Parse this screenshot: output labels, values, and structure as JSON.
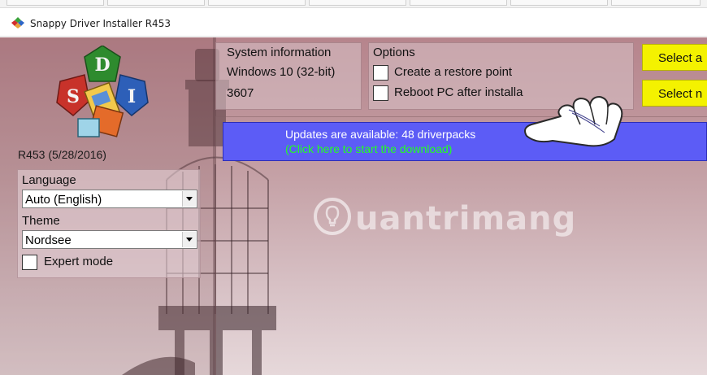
{
  "window": {
    "title": "Snappy Driver Installer R453"
  },
  "sidebar": {
    "version": "R453 (5/28/2016)",
    "language_label": "Language",
    "language_value": "Auto (English)",
    "theme_label": "Theme",
    "theme_value": "Nordsee",
    "expert_mode_label": "Expert mode",
    "expert_mode_checked": false
  },
  "logo": {
    "letters": [
      "D",
      "S",
      "I"
    ]
  },
  "system_info": {
    "header": "System information",
    "os": "Windows 10 (32-bit)",
    "build": "3607"
  },
  "options": {
    "header": "Options",
    "items": [
      {
        "label": "Create a restore point",
        "checked": false
      },
      {
        "label": "Reboot PC after installa",
        "checked": false
      }
    ]
  },
  "buttons": {
    "select_all": "Select a",
    "select_none": "Select n"
  },
  "update_banner": {
    "line1": "Updates are available: 48 driverpacks",
    "line2": "(Click here to start the download)"
  },
  "watermark": {
    "text": "uantrimang"
  },
  "colors": {
    "banner_bg": "#5c5cf6",
    "banner_link": "#22ff22",
    "select_button": "#f4f200",
    "background": "#c4a0a5"
  },
  "icons": [
    "app-icon",
    "chevron-down-icon",
    "pointing-hand-icon",
    "lightbulb-icon"
  ]
}
